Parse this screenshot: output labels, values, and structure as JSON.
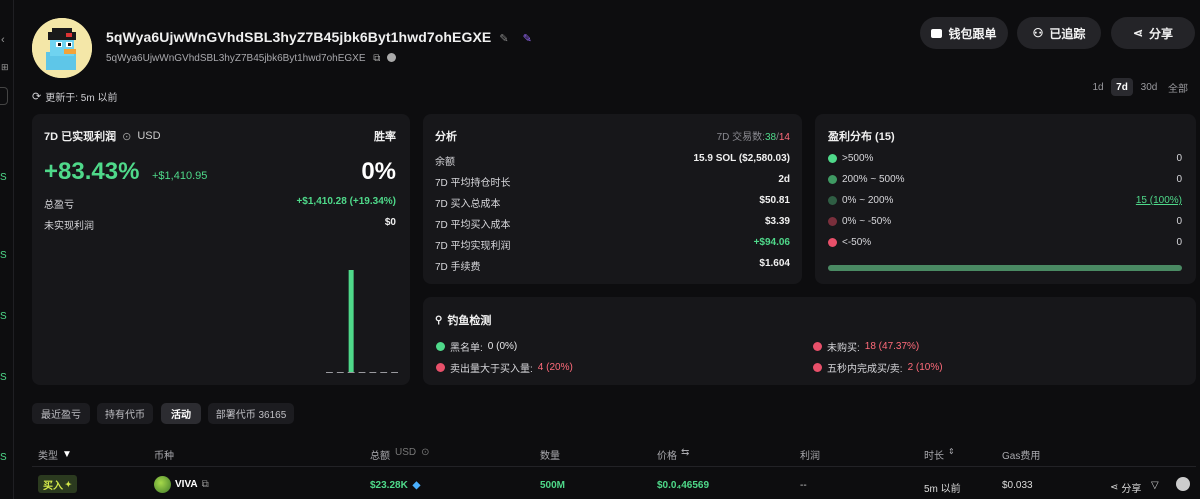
{
  "sidebar": {
    "marks": [
      "S",
      "S",
      "S",
      "S",
      "S"
    ]
  },
  "wallet": {
    "name": "5qWya6UjwWnGVhdSBL3hyZ7B45jbk6Byt1hwd7ohEGXE",
    "address": "5qWya6UjwWnGVhdSBL3hyZ7B45jbk6Byt1hwd7ohEGXE",
    "updated": "更新于: 5m 以前"
  },
  "header_buttons": {
    "copytrade": "钱包跟单",
    "tracked": "已追踪",
    "share": "分享"
  },
  "timeframes": [
    "1d",
    "7d",
    "30d",
    "全部"
  ],
  "timeframe_active": "7d",
  "pnl_card": {
    "title": "7D 已实现利润",
    "currency": "USD",
    "winrate_label": "胜率",
    "pnl_pct": "+83.43%",
    "pnl_usd": "+$1,410.95",
    "winrate": "0%",
    "total_label": "总盈亏",
    "total_value": "+$1,410.28 (+19.34%)",
    "unrealized_label": "未实现利润",
    "unrealized_value": "$0"
  },
  "chart_data": {
    "type": "bar",
    "title": "",
    "categories": [
      "1",
      "2",
      "3",
      "4",
      "5",
      "6",
      "7"
    ],
    "values": [
      0,
      0,
      1410.95,
      0,
      0,
      0,
      0
    ],
    "xlabel": "",
    "ylabel": "",
    "bar_color": "#4fd98a",
    "baseline_color": "#9a9a9f"
  },
  "analysis": {
    "title": "分析",
    "trades_label": "7D 交易数:",
    "trades_buy": "38",
    "trades_sep": "/",
    "trades_sell": "14",
    "rows": [
      {
        "label": "余额",
        "value": "15.9 SOL ($2,580.03)"
      },
      {
        "label": "7D 平均持仓时长",
        "value": "2d"
      },
      {
        "label": "7D 买入总成本",
        "value": "$50.81"
      },
      {
        "label": "7D 平均买入成本",
        "value": "$3.39"
      },
      {
        "label": "7D 平均实现利润",
        "value": "+$94.06"
      },
      {
        "label": "7D 手续费",
        "value": "$1.604"
      }
    ]
  },
  "distribution": {
    "title": "盈利分布 (15)",
    "rows": [
      {
        "label": ">500%",
        "value": "0",
        "color": "#4fd98a"
      },
      {
        "label": "200% ~ 500%",
        "value": "0",
        "color": "#3f9a63"
      },
      {
        "label": "0% ~ 200%",
        "value": "15 (100%)",
        "color": "#2f5e44"
      },
      {
        "label": "0% ~ -50%",
        "value": "0",
        "color": "#7a2f3c"
      },
      {
        "label": "<-50%",
        "value": "0",
        "color": "#e8506a"
      }
    ],
    "bar_fraction": 1.0
  },
  "phishing": {
    "title": "钓鱼检测",
    "items": [
      {
        "label": "黑名单:",
        "value": "0 (0%)",
        "color": "#4fd98a"
      },
      {
        "label": "未购买:",
        "value": "18 (47.37%)",
        "color": "#e8506a"
      },
      {
        "label": "卖出量大于买入量:",
        "value": "4 (20%)",
        "color": "#e8506a"
      },
      {
        "label": "五秒内完成买/卖:",
        "value": "2 (10%)",
        "color": "#e8506a"
      }
    ]
  },
  "tabs": [
    "最近盈亏",
    "持有代币",
    "活动",
    "部署代币 36165"
  ],
  "tab_active": "活动",
  "table": {
    "headers": [
      "类型",
      "币种",
      "总额",
      "USD",
      "数量",
      "价格",
      "利润",
      "时长",
      "Gas费用"
    ],
    "row": {
      "type": "买入",
      "token": "VIVA",
      "total": "$23.28K",
      "amount": "500M",
      "price": "$0.0₄46569",
      "profit": "--",
      "age": "5m 以前",
      "gas": "$0.033",
      "share": "分享"
    }
  }
}
